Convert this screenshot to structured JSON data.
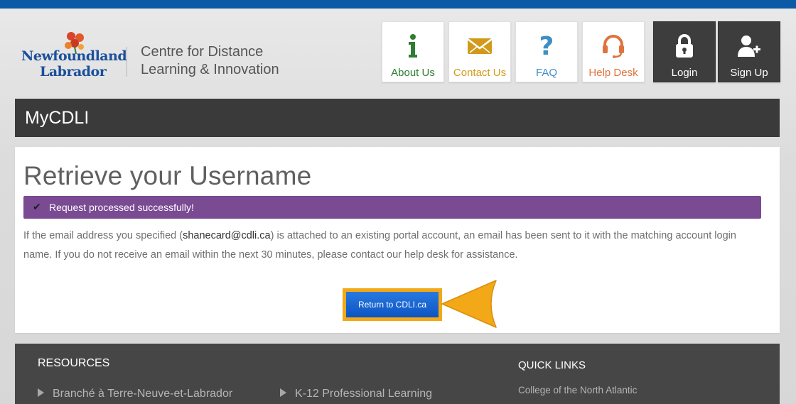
{
  "brand": {
    "logo_line1": "Newfoundland",
    "logo_line2": "Labrador",
    "org_name": "Centre for Distance Learning & Innovation",
    "colors": {
      "top_bar": "#0b5aa6",
      "alert": "#7a4a93",
      "button": "#0c55c3",
      "highlight": "#f2a817"
    }
  },
  "nav": {
    "items": [
      {
        "label": "About Us",
        "icon": "info-icon",
        "color": "#2e7d32"
      },
      {
        "label": "Contact Us",
        "icon": "envelope-icon",
        "color": "#d19a1a"
      },
      {
        "label": "FAQ",
        "icon": "question-icon",
        "color": "#3e8fc4"
      },
      {
        "label": "Help Desk",
        "icon": "headset-icon",
        "color": "#e0733d"
      },
      {
        "label": "Login",
        "icon": "lock-icon",
        "color": "#ffffff"
      },
      {
        "label": "Sign Up",
        "icon": "add-user-icon",
        "color": "#ffffff"
      }
    ]
  },
  "section_title": "MyCDLI",
  "main": {
    "heading": "Retrieve your Username",
    "alert": "Request processed successfully!",
    "body_pre": "If the email address you specified (",
    "email": "shanecard@cdli.ca",
    "body_post": ") is attached to an existing portal account, an email has been sent to it with the matching account login name. If you do not receive an email within the next 30 minutes, please contact our help desk for assistance.",
    "button": "Return to CDLI.ca"
  },
  "footer": {
    "resources_title": "RESOURCES",
    "resources": [
      "Branché à Terre-Neuve-et-Labrador",
      "K-12 Professional Learning"
    ],
    "quick_links_title": "QUICK LINKS",
    "quick_links": [
      "College of the North Atlantic"
    ]
  }
}
